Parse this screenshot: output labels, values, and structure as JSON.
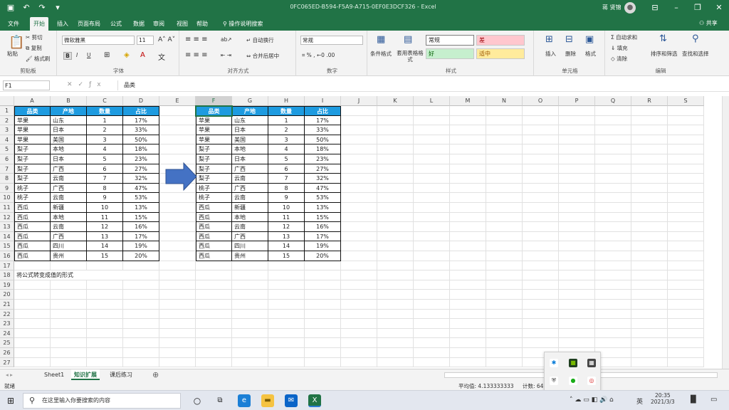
{
  "window": {
    "title": "0FC065ED-B594-F5A9-A715-0EF0E3DCF326  -  Excel",
    "user": "蒋 贤锦"
  },
  "tabs": [
    "文件",
    "开始",
    "插入",
    "页面布局",
    "公式",
    "数据",
    "审阅",
    "视图",
    "帮助"
  ],
  "active_tab": "开始",
  "tell_me": "操作说明搜索",
  "share": "共享",
  "ribbon": {
    "clipboard": {
      "label": "剪贴板",
      "paste": "粘贴",
      "cut": "剪切",
      "copy": "复制",
      "format_painter": "格式刷"
    },
    "font": {
      "label": "字体",
      "name": "微软雅黑",
      "size": "11",
      "bold": "B",
      "italic": "I",
      "underline": "U"
    },
    "alignment": {
      "label": "对齐方式",
      "wrap": "自动换行",
      "merge": "合并后居中"
    },
    "number": {
      "label": "数字",
      "format": "常规"
    },
    "styles": {
      "label": "样式",
      "cond": "条件格式",
      "table": "套用表格格式",
      "normal": "常规",
      "bad": "差",
      "good": "好",
      "neutral": "适中"
    },
    "cells": {
      "label": "单元格",
      "insert": "插入",
      "delete": "删除",
      "format": "格式"
    },
    "editing": {
      "label": "编辑",
      "autosum": "自动求和",
      "fill": "填充",
      "clear": "清除",
      "sort": "排序和筛选",
      "find": "查找和选择"
    }
  },
  "formula_bar": {
    "name_box": "F1",
    "content": "品类"
  },
  "columns": [
    "A",
    "B",
    "C",
    "D",
    "E",
    "F",
    "G",
    "H",
    "I",
    "J",
    "K",
    "L",
    "M",
    "N",
    "O",
    "P",
    "Q",
    "R",
    "S"
  ],
  "rows": [
    "1",
    "2",
    "3",
    "4",
    "5",
    "6",
    "7",
    "8",
    "9",
    "10",
    "11",
    "12",
    "13",
    "14",
    "15",
    "16",
    "17",
    "18",
    "19",
    "20",
    "21",
    "22",
    "23",
    "24",
    "25",
    "26",
    "27"
  ],
  "table": {
    "headers": [
      "品类",
      "产地",
      "数量",
      "占比"
    ],
    "rows": [
      [
        "苹果",
        "山东",
        "1",
        "17%"
      ],
      [
        "苹果",
        "日本",
        "2",
        "33%"
      ],
      [
        "苹果",
        "美国",
        "3",
        "50%"
      ],
      [
        "梨子",
        "本地",
        "4",
        "18%"
      ],
      [
        "梨子",
        "日本",
        "5",
        "23%"
      ],
      [
        "梨子",
        "广西",
        "6",
        "27%"
      ],
      [
        "梨子",
        "云南",
        "7",
        "32%"
      ],
      [
        "桃子",
        "广西",
        "8",
        "47%"
      ],
      [
        "桃子",
        "云南",
        "9",
        "53%"
      ],
      [
        "西瓜",
        "新疆",
        "10",
        "13%"
      ],
      [
        "西瓜",
        "本地",
        "11",
        "15%"
      ],
      [
        "西瓜",
        "云南",
        "12",
        "16%"
      ],
      [
        "西瓜",
        "广西",
        "13",
        "17%"
      ],
      [
        "西瓜",
        "四川",
        "14",
        "19%"
      ],
      [
        "西瓜",
        "贵州",
        "15",
        "20%"
      ]
    ]
  },
  "note": "将公式转变成值的形式",
  "sheets": [
    "Sheet1",
    "知识扩展",
    "课后练习"
  ],
  "active_sheet": "知识扩展",
  "status": {
    "mode": "就绪",
    "average": "平均值: 4.133333333",
    "count": "计数: 64"
  },
  "taskbar": {
    "search": "在这里输入你要搜索的内容",
    "time": "20:35",
    "date": "2021/3/3",
    "ime": "英"
  },
  "colors": {
    "excel_green": "#217346",
    "header_blue": "#1e9be0",
    "arrow_blue": "#4472c4"
  }
}
